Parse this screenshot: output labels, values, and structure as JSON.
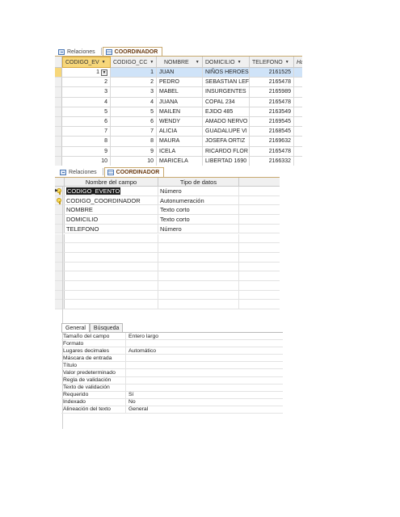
{
  "tabs_top": [
    {
      "label": "Relaciones",
      "icon": "relationships-icon",
      "active": false
    },
    {
      "label": "COORDINADOR",
      "icon": "table-icon",
      "active": true
    }
  ],
  "tabs_design": [
    {
      "label": "Relaciones",
      "icon": "relationships-icon",
      "active": false
    },
    {
      "label": "COORDINADOR",
      "icon": "table-icon",
      "active": true
    }
  ],
  "datasheet": {
    "columns": [
      "CODIGO_EV",
      "CODIGO_CC",
      "NOMBRE",
      "DOMICILIO",
      "TELEFONO",
      "Ha"
    ],
    "rows": [
      {
        "codigo_ev": "1",
        "codigo_cc": "1",
        "nombre": "JUAN",
        "domicilio": "NIÑOS HEROES",
        "telefono": "2161525"
      },
      {
        "codigo_ev": "2",
        "codigo_cc": "2",
        "nombre": "PEDRO",
        "domicilio": "SEBASTIAN LEF",
        "telefono": "2165478"
      },
      {
        "codigo_ev": "3",
        "codigo_cc": "3",
        "nombre": "MABEL",
        "domicilio": "INSURGENTES",
        "telefono": "2165989"
      },
      {
        "codigo_ev": "4",
        "codigo_cc": "4",
        "nombre": "JUANA",
        "domicilio": "COPAL 234",
        "telefono": "2165478"
      },
      {
        "codigo_ev": "5",
        "codigo_cc": "5",
        "nombre": "MAILEN",
        "domicilio": "EJIDO 485",
        "telefono": "2163549"
      },
      {
        "codigo_ev": "6",
        "codigo_cc": "6",
        "nombre": "WENDY",
        "domicilio": "AMADO NERVO",
        "telefono": "2169545"
      },
      {
        "codigo_ev": "7",
        "codigo_cc": "7",
        "nombre": "ALICIA",
        "domicilio": "GUADALUPE VI",
        "telefono": "2168545"
      },
      {
        "codigo_ev": "8",
        "codigo_cc": "8",
        "nombre": "MAURA",
        "domicilio": "JOSEFA ORTIZ",
        "telefono": "2169632"
      },
      {
        "codigo_ev": "9",
        "codigo_cc": "9",
        "nombre": "ICELA",
        "domicilio": "RICARDO FLOR",
        "telefono": "2165478"
      },
      {
        "codigo_ev": "10",
        "codigo_cc": "10",
        "nombre": "MARICELA",
        "domicilio": "LIBERTAD 1690",
        "telefono": "2166332"
      }
    ]
  },
  "design": {
    "headers": [
      "Nombre del campo",
      "Tipo de datos"
    ],
    "fields": [
      {
        "name": "CODIGO_EVENTO",
        "type": "Número",
        "key": true,
        "highlight": true
      },
      {
        "name": "CODIGO_COORDINADOR",
        "type": "Autonumeración",
        "key": true,
        "highlight": false
      },
      {
        "name": "NOMBRE",
        "type": "Texto corto",
        "key": false,
        "highlight": false
      },
      {
        "name": "DOMICILIO",
        "type": "Texto corto",
        "key": false,
        "highlight": false
      },
      {
        "name": "TELEFONO",
        "type": "Número",
        "key": false,
        "highlight": false
      }
    ]
  },
  "properties": {
    "tabs": [
      "General",
      "Búsqueda"
    ],
    "rows": [
      {
        "key": "Tamaño del campo",
        "value": "Entero largo"
      },
      {
        "key": "Formato",
        "value": ""
      },
      {
        "key": "Lugares decimales",
        "value": "Automático"
      },
      {
        "key": "Máscara de entrada",
        "value": ""
      },
      {
        "key": "Título",
        "value": ""
      },
      {
        "key": "Valor predeterminado",
        "value": ""
      },
      {
        "key": "Regla de validación",
        "value": ""
      },
      {
        "key": "Texto de validación",
        "value": ""
      },
      {
        "key": "Requerido",
        "value": "Sí"
      },
      {
        "key": "Indexado",
        "value": "No"
      },
      {
        "key": "Alineación del texto",
        "value": "General"
      }
    ]
  }
}
